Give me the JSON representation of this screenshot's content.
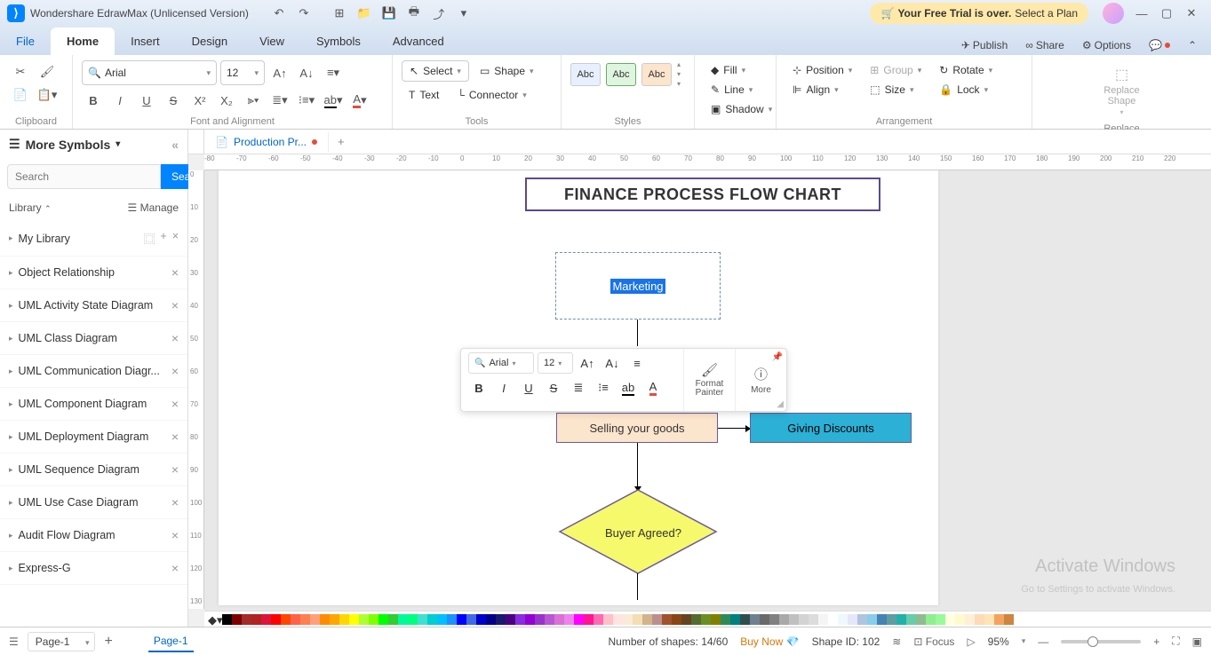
{
  "titlebar": {
    "title": "Wondershare EdrawMax (Unlicensed Version)",
    "trial": {
      "text1": "Your Free Trial is over.",
      "text2": "Select a Plan"
    }
  },
  "menu": {
    "tabs": [
      "File",
      "Home",
      "Insert",
      "Design",
      "View",
      "Symbols",
      "Advanced"
    ],
    "right": {
      "publish": "Publish",
      "share": "Share",
      "options": "Options"
    }
  },
  "ribbon": {
    "groups": [
      "Clipboard",
      "Font and Alignment",
      "",
      "Tools",
      "Styles",
      "",
      "Arrangement",
      "Replace"
    ],
    "font": {
      "family": "Arial",
      "size": "12"
    },
    "select": "Select",
    "shape": "Shape",
    "text": "Text",
    "connector": "Connector",
    "styles": {
      "abc": "Abc"
    },
    "fill": "Fill",
    "line": "Line",
    "shadow": "Shadow",
    "position": "Position",
    "align": "Align",
    "group": "Group",
    "size": "Size",
    "rotate": "Rotate",
    "lock": "Lock",
    "replace": "Replace\nShape"
  },
  "sidebar": {
    "title": "More Symbols",
    "search_placeholder": "Search",
    "search_btn": "Search",
    "library": "Library",
    "manage": "Manage",
    "items": [
      "My Library",
      "Object Relationship",
      "UML Activity State Diagram",
      "UML Class Diagram",
      "UML Communication Diagr...",
      "UML Component Diagram",
      "UML Deployment Diagram",
      "UML Sequence Diagram",
      "UML Use Case Diagram",
      "Audit Flow Diagram",
      "Express-G"
    ]
  },
  "doc_tab": "Production Pr...",
  "chart": {
    "title": "FINANCE PROCESS FLOW CHART",
    "marketing": "Marketing",
    "selling": "Selling your goods",
    "discount": "Giving Discounts",
    "buyer": "Buyer Agreed?"
  },
  "float_tb": {
    "font": "Arial",
    "size": "12",
    "format_painter": "Format\nPainter",
    "more": "More"
  },
  "ruler_h": [
    "-80",
    "-70",
    "-60",
    "-50",
    "-40",
    "-30",
    "-20",
    "-10",
    "0",
    "10",
    "20",
    "30",
    "40",
    "50",
    "60",
    "70",
    "80",
    "90",
    "100",
    "110",
    "120",
    "130",
    "140",
    "150",
    "160",
    "170",
    "180",
    "190",
    "200",
    "210",
    "220"
  ],
  "ruler_v": [
    "0",
    "10",
    "20",
    "30",
    "40",
    "50",
    "60",
    "70",
    "80",
    "90",
    "100",
    "110",
    "120",
    "130"
  ],
  "colors": [
    "#000",
    "#7f0000",
    "#a52a2a",
    "#b22222",
    "#dc143c",
    "#ff0000",
    "#ff4500",
    "#ff6347",
    "#ff7f50",
    "#ffa07a",
    "#ff8c00",
    "#ffa500",
    "#ffd700",
    "#ffff00",
    "#adff2f",
    "#7fff00",
    "#00ff00",
    "#32cd32",
    "#00fa9a",
    "#00ff7f",
    "#40e0d0",
    "#00ced1",
    "#00bfff",
    "#1e90ff",
    "#0000ff",
    "#4169e1",
    "#0000cd",
    "#00008b",
    "#191970",
    "#4b0082",
    "#8a2be2",
    "#9400d3",
    "#9932cc",
    "#ba55d3",
    "#da70d6",
    "#ee82ee",
    "#ff00ff",
    "#ff1493",
    "#ff69b4",
    "#ffc0cb",
    "#ffe4e1",
    "#faebd7",
    "#f5deb3",
    "#d2b48c",
    "#bc8f8f",
    "#a0522d",
    "#8b4513",
    "#654321",
    "#556b2f",
    "#6b8e23",
    "#808000",
    "#2e8b57",
    "#008080",
    "#2f4f4f",
    "#708090",
    "#696969",
    "#808080",
    "#a9a9a9",
    "#c0c0c0",
    "#d3d3d3",
    "#dcdcdc",
    "#f5f5f5",
    "#fff",
    "#f0f8ff",
    "#e6e6fa",
    "#b0c4de",
    "#87ceeb",
    "#4682b4",
    "#5f9ea0",
    "#20b2aa",
    "#66cdaa",
    "#8fbc8f",
    "#90ee90",
    "#98fb98",
    "#ffffe0",
    "#fffacd",
    "#ffefd5",
    "#ffdab9",
    "#ffe4b5",
    "#f4a460",
    "#cd853f"
  ],
  "statusbar": {
    "page_sel": "Page-1",
    "page_tab": "Page-1",
    "shapes": "Number of shapes: 14/60",
    "buy": "Buy Now",
    "shape_id": "Shape ID: 102",
    "focus": "Focus",
    "zoom": "95%"
  },
  "watermark": {
    "main": "Activate Windows",
    "sub": "Go to Settings to activate Windows."
  }
}
